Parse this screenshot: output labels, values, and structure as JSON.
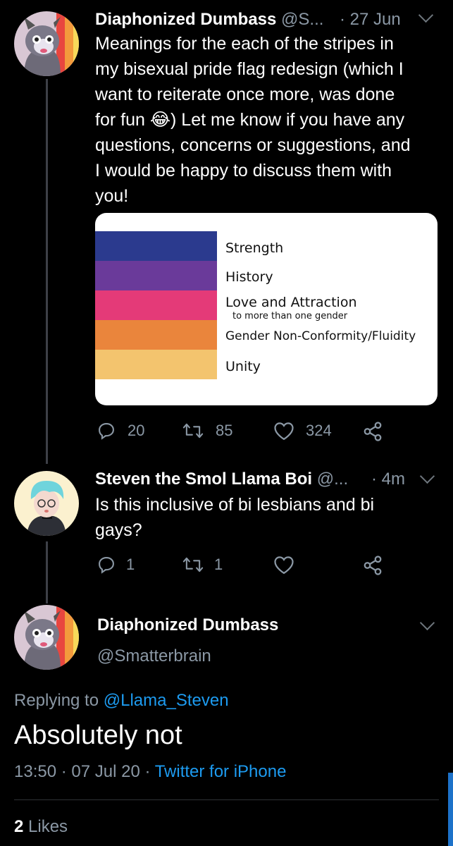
{
  "tweet1": {
    "name": "Diaphonized Dumbass",
    "handle": "@S...",
    "time": "· 27 Jun",
    "text_lines": [
      "Meanings for the each of the stripes in",
      "my bisexual pride flag redesign (which I",
      "want to reiterate once more, was done",
      "for fun 😂) Let me know if you have any",
      "questions, concerns or suggestions, and",
      "I would be happy to discuss them with",
      "you!"
    ],
    "flag": {
      "stripes": [
        {
          "color": "#2b3a8e",
          "label": "Strength"
        },
        {
          "color": "#6a3a9a",
          "label": "History"
        },
        {
          "color": "#e43a78",
          "label": "Love and Attraction",
          "sublabel": "to more than one gender"
        },
        {
          "color": "#ea853c",
          "label": "Gender Non-Conformity/Fluidity"
        },
        {
          "color": "#f3c46e",
          "label": "Unity"
        }
      ]
    },
    "actions": {
      "replies": "20",
      "retweets": "85",
      "likes": "324"
    }
  },
  "tweet2": {
    "name": "Steven the Smol Llama Boi",
    "handle": "@...",
    "time": "· 4m",
    "text_lines": [
      "Is this inclusive of bi lesbians and bi",
      "gays?"
    ],
    "actions": {
      "replies": "1",
      "retweets": "1"
    }
  },
  "main_tweet": {
    "name": "Diaphonized Dumbass",
    "handle": "@Smatterbrain",
    "replying_prefix": "Replying to",
    "replying_to": "@Llama_Steven",
    "text": "Absolutely not",
    "timestamp": "13:50 · 07 Jul 20 · ",
    "source": "Twitter for iPhone",
    "likes_count": "2",
    "likes_label": "Likes"
  },
  "colors": {
    "accent": "#1d9bf0",
    "muted": "#8b98a5",
    "background": "#000000"
  }
}
